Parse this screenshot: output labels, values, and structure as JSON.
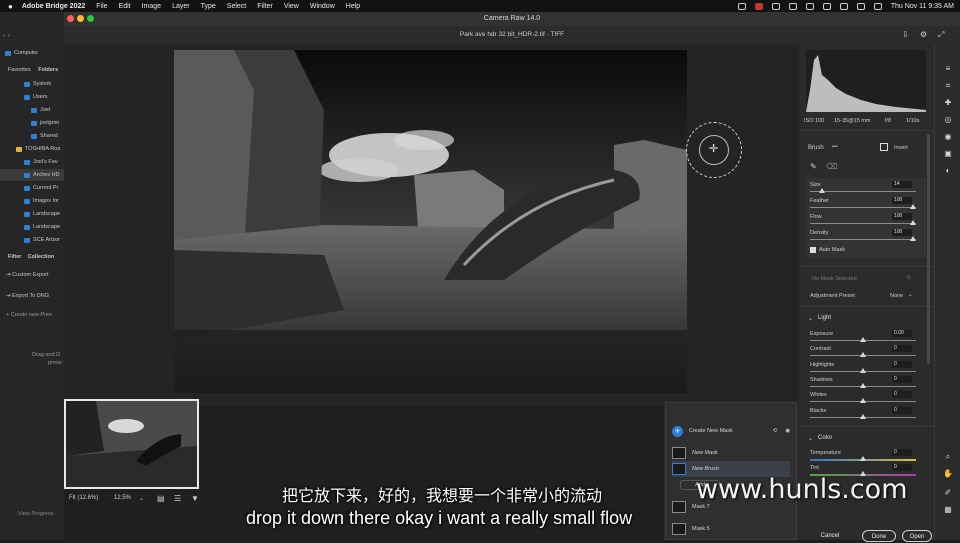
{
  "menubar": {
    "app_name": "Adobe Bridge 2022",
    "items": [
      "File",
      "Edit",
      "Image",
      "Layer",
      "Type",
      "Select",
      "Filter",
      "View",
      "Window",
      "Help"
    ],
    "clock": "Thu Nov 11  9:35 AM"
  },
  "bridge": {
    "computer_label": "Computer",
    "tabs": [
      "Favorites",
      "Folders"
    ],
    "tree": [
      "System",
      "Users",
      "Joel",
      "joelgrim",
      "Shared",
      "TOSHIBA Roa",
      "Joel's Fav",
      "Arches HD",
      "Current Pr",
      "Images for",
      "Landscape",
      "Landscape",
      "SCE Arizor"
    ],
    "bottom_tabs": [
      "Filter",
      "Collection"
    ],
    "actions": [
      "Custom Export",
      "Export To DNG",
      "Create new Pres"
    ],
    "drag_hint": [
      "Drag and D",
      "prese"
    ],
    "view_progress": "View Progress"
  },
  "camera_raw": {
    "window_title": "Camera Raw 14.0",
    "file_name": "Park ave hdr 32 bit_HDR-2.tif  ·  TIFF",
    "zoom": {
      "fit_label": "Fit (12.6%)",
      "value": "12.5%"
    },
    "exif": {
      "iso": "ISO 100",
      "lens": "15-35@15 mm",
      "aperture": "f/8",
      "shutter": "1/10s"
    },
    "brush": {
      "title": "Brush",
      "more": "•••",
      "invert_label": "Invert",
      "sliders": [
        {
          "label": "Size",
          "value": "14",
          "fraction": 0.12
        },
        {
          "label": "Feather",
          "value": "100",
          "fraction": 1.0
        },
        {
          "label": "Flow",
          "value": "100",
          "fraction": 1.0
        },
        {
          "label": "Density",
          "value": "100",
          "fraction": 1.0
        }
      ],
      "auto_mask_label": "Auto Mask"
    },
    "no_mask_label": "No Mask Selected",
    "adjustment_preset": {
      "label": "Adjustment Preset",
      "value": "None"
    },
    "light": {
      "title": "Light",
      "sliders": [
        {
          "label": "Exposure",
          "value": "0.00"
        },
        {
          "label": "Contrast",
          "value": "0"
        },
        {
          "label": "Highlights",
          "value": "0"
        },
        {
          "label": "Shadows",
          "value": "0"
        },
        {
          "label": "Whites",
          "value": "0"
        },
        {
          "label": "Blacks",
          "value": "0"
        }
      ]
    },
    "color": {
      "title": "Color",
      "sliders": [
        {
          "label": "Temperature",
          "value": "0"
        },
        {
          "label": "Tint",
          "value": "0"
        }
      ]
    },
    "mask_panel": {
      "create_label": "Create New Mask",
      "items": [
        "New Mask",
        "New Brush",
        "Add",
        "Mask 7",
        "Mask 5"
      ]
    },
    "buttons": {
      "cancel": "Cancel",
      "done": "Done",
      "open": "Open"
    }
  },
  "subtitles": {
    "cn": "把它放下来，好的，我想要一个非常小的流动",
    "en": "drop it down there okay i want a really small flow"
  },
  "watermark": "www.hunls.com",
  "colors": {
    "accent": "#2f7fd6",
    "folder": "#e7b43a",
    "close": "#ff5f57",
    "minimize": "#febc2e",
    "zoom": "#28c840"
  }
}
